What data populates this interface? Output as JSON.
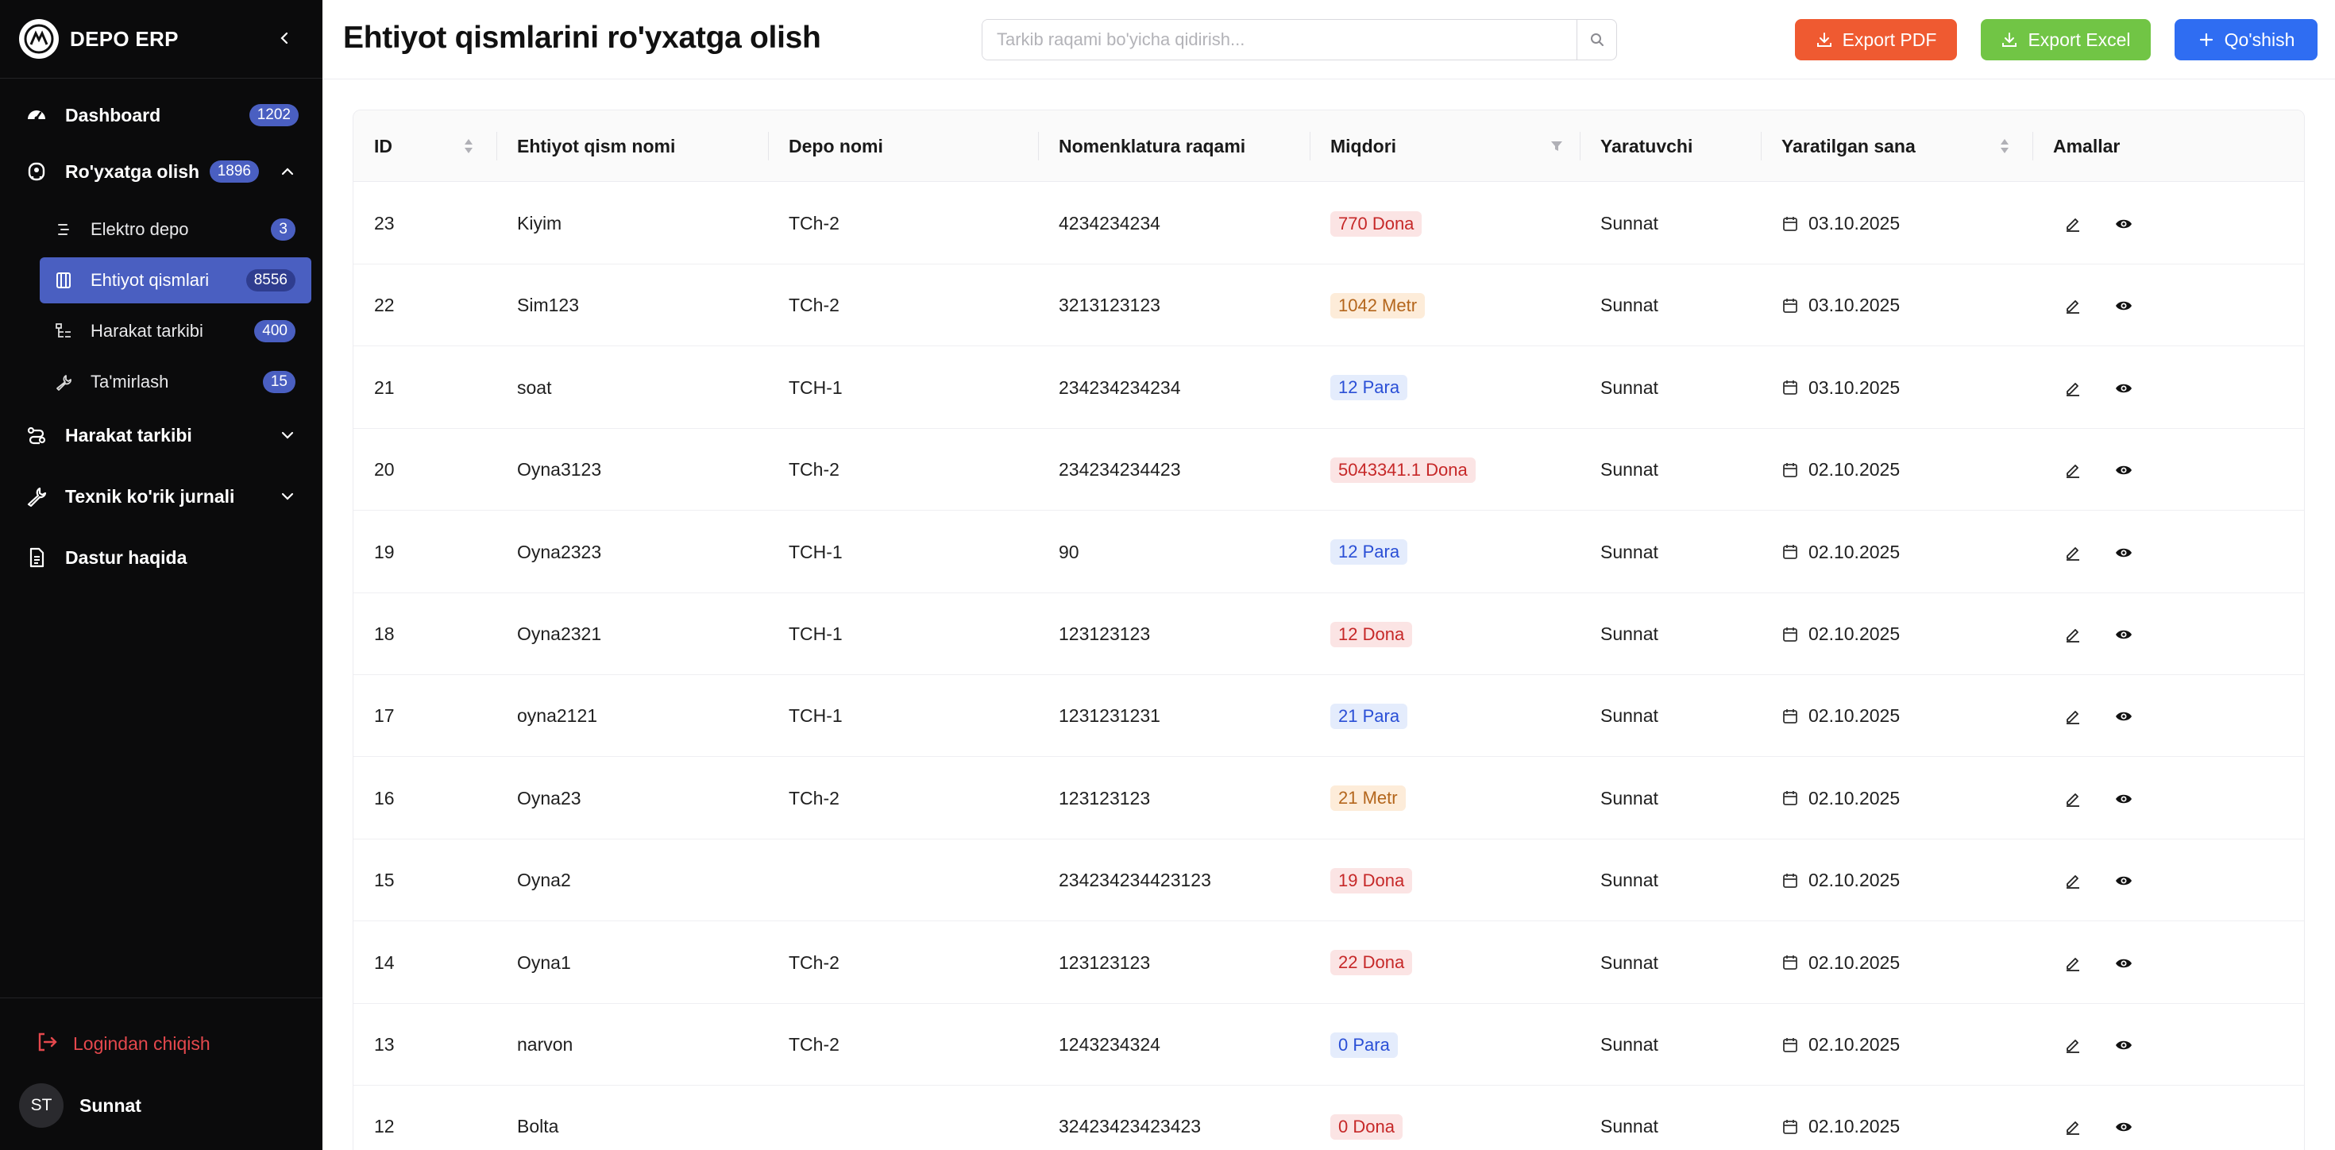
{
  "app": {
    "name": "DEPO ERP"
  },
  "sidebar": {
    "items": [
      {
        "label": "Dashboard",
        "badge": "1202",
        "icon": "dashboard-icon"
      },
      {
        "label": "Ro'yxatga olish",
        "badge": "1896",
        "icon": "registration-icon",
        "expanded": true,
        "children": [
          {
            "label": "Elektro depo",
            "badge": "3",
            "icon": "list-icon"
          },
          {
            "label": "Ehtiyot qismlari",
            "badge": "8556",
            "icon": "parts-icon",
            "active": true
          },
          {
            "label": "Harakat tarkibi",
            "badge": "400",
            "icon": "tree-icon"
          },
          {
            "label": "Ta'mirlash",
            "badge": "15",
            "icon": "wrench-icon"
          }
        ]
      },
      {
        "label": "Harakat tarkibi",
        "icon": "route-icon",
        "expanded": false
      },
      {
        "label": "Texnik ko'rik jurnali",
        "icon": "wrench-icon",
        "expanded": false
      },
      {
        "label": "Dastur haqida",
        "icon": "document-icon"
      }
    ],
    "logout_label": "Logindan chiqish",
    "user": {
      "initials": "ST",
      "name": "Sunnat"
    }
  },
  "header": {
    "title": "Ehtiyot qismlarini ro'yxatga olish",
    "search_placeholder": "Tarkib raqami bo'yicha qidirish...",
    "export_pdf_label": "Export PDF",
    "export_excel_label": "Export Excel",
    "add_label": "Qo'shish"
  },
  "colors": {
    "sidebar_bg": "#0b0b0c",
    "accent": "#4a5fc1",
    "pdf": "#ef5a31",
    "excel": "#71c545",
    "add": "#2f6df2",
    "logout": "#e5484d"
  },
  "table": {
    "columns": [
      "ID",
      "Ehtiyot qism nomi",
      "Depo nomi",
      "Nomenklatura raqami",
      "Miqdori",
      "Yaratuvchi",
      "Yaratilgan sana",
      "Amallar"
    ],
    "rows": [
      {
        "id": "23",
        "name": "Kiyim",
        "depo": "TCh-2",
        "nomen": "4234234234",
        "qty": "770 Dona",
        "unit": "dona",
        "creator": "Sunnat",
        "date": "03.10.2025"
      },
      {
        "id": "22",
        "name": "Sim123",
        "depo": "TCh-2",
        "nomen": "3213123123",
        "qty": "1042 Metr",
        "unit": "metr",
        "creator": "Sunnat",
        "date": "03.10.2025"
      },
      {
        "id": "21",
        "name": "soat",
        "depo": "TCH-1",
        "nomen": "234234234234",
        "qty": "12 Para",
        "unit": "para",
        "creator": "Sunnat",
        "date": "03.10.2025"
      },
      {
        "id": "20",
        "name": "Oyna3123",
        "depo": "TCh-2",
        "nomen": "234234234423",
        "qty": "5043341.1 Dona",
        "unit": "dona",
        "creator": "Sunnat",
        "date": "02.10.2025"
      },
      {
        "id": "19",
        "name": "Oyna2323",
        "depo": "TCH-1",
        "nomen": "90",
        "qty": "12 Para",
        "unit": "para",
        "creator": "Sunnat",
        "date": "02.10.2025"
      },
      {
        "id": "18",
        "name": "Oyna2321",
        "depo": "TCH-1",
        "nomen": "123123123",
        "qty": "12 Dona",
        "unit": "dona",
        "creator": "Sunnat",
        "date": "02.10.2025"
      },
      {
        "id": "17",
        "name": "oyna2121",
        "depo": "TCH-1",
        "nomen": "1231231231",
        "qty": "21 Para",
        "unit": "para",
        "creator": "Sunnat",
        "date": "02.10.2025"
      },
      {
        "id": "16",
        "name": "Oyna23",
        "depo": "TCh-2",
        "nomen": "123123123",
        "qty": "21 Metr",
        "unit": "metr",
        "creator": "Sunnat",
        "date": "02.10.2025"
      },
      {
        "id": "15",
        "name": "Oyna2",
        "depo": "",
        "nomen": "234234234423123",
        "qty": "19 Dona",
        "unit": "dona",
        "creator": "Sunnat",
        "date": "02.10.2025"
      },
      {
        "id": "14",
        "name": "Oyna1",
        "depo": "TCh-2",
        "nomen": "123123123",
        "qty": "22 Dona",
        "unit": "dona",
        "creator": "Sunnat",
        "date": "02.10.2025"
      },
      {
        "id": "13",
        "name": "narvon",
        "depo": "TCh-2",
        "nomen": "1243234324",
        "qty": "0 Para",
        "unit": "para",
        "creator": "Sunnat",
        "date": "02.10.2025"
      },
      {
        "id": "12",
        "name": "Bolta",
        "depo": "",
        "nomen": "32423423423423",
        "qty": "0 Dona",
        "unit": "dona",
        "creator": "Sunnat",
        "date": "02.10.2025"
      }
    ]
  }
}
